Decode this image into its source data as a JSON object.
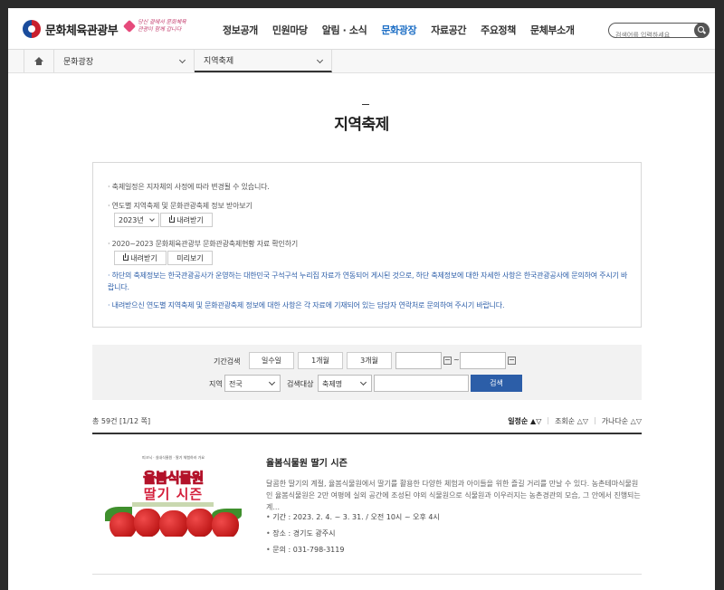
{
  "header": {
    "logo_text": "문화체육관광부",
    "slogan_lines": [
      "당신 곁에서 문화체육",
      "관광이 함께 갑니다"
    ],
    "nav": [
      "정보공개",
      "민원마당",
      "알림 · 소식",
      "문화광장",
      "자료공간",
      "주요정책",
      "문체부소개"
    ],
    "active_nav": "문화광장",
    "search_placeholder": "검색어를 입력하세요"
  },
  "breadcrumb": {
    "level1": "문화광장",
    "level2": "지역축제"
  },
  "page_title": "지역축제",
  "info": {
    "note1": "· 축제일정은 지자체의 사정에 따라 변경될 수 있습니다.",
    "note2": "· 연도별 지역축제 및 문화관광축제 정보 받아보기",
    "year_value": "2023년",
    "download_label": "내려받기",
    "note3": "· 2020~2023 문화체육관광부 문화관광축제현황 자료 확인하기",
    "download_label2": "내려받기",
    "preview_label": "미리보기",
    "note4": "· 하단의 축제정보는 한국관광공사가 운영하는 대한민국 구석구석 누리집 자료가 연동되어 게시된 것으로, 하단 축제정보에 대한 자세한 사항은 한국관광공사에 문의하여 주시기 바랍니다.",
    "note5": "· 내려받으신 연도별 지역축제 및 문화관광축제 정보에 대한 사항은 각 자료에 기재되어 있는 담당자 연락처로 문의하여 주시기 바랍니다."
  },
  "filter": {
    "period_label": "기간검색",
    "period_buttons": [
      "일수일",
      "1개월",
      "3개월"
    ],
    "tilde": "~",
    "region_label": "지역",
    "region_value": "전국",
    "target_label": "검색대상",
    "target_value": "축제명",
    "search_button": "검색"
  },
  "results": {
    "total": "총 59건 [1/12 쪽]",
    "sorts": [
      "일정순 ▲▽",
      "조회순 △▽",
      "가나다순 △▽"
    ],
    "sort_sep": "|"
  },
  "item": {
    "thumb_top": "피크닉 · 실내식물원 · 딸기 체험하러 가요",
    "thumb_title1": "율봄식물원",
    "thumb_title2": "딸기 시즌",
    "title": "율봄식물원 딸기 시즌",
    "desc": "달콤한 딸기의 계절, 율봄식물원에서 딸기를 활용한 다양한 체험과 아이들을 위한 즐길 거리를 만날 수 있다. 농촌테마식물원인 율봄식물원은 2만 여평에 실외 공간에 조성된 야외 식물원으로 식물원과 이우러지는 농촌경관의 모습, 그 안에서 진행되는 계...",
    "period": "기간 : 2023. 2. 4. ~ 3. 31. / 오전 10시 ~ 오후 4시",
    "place": "장소 : 경기도 광주시",
    "contact": "문의 : 031-798-3119"
  }
}
